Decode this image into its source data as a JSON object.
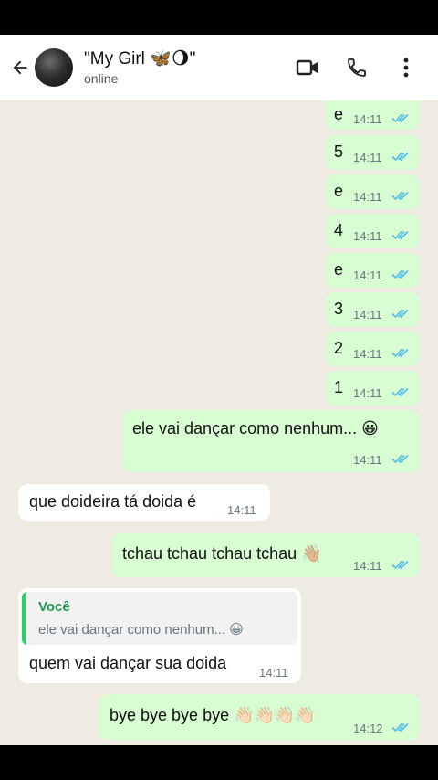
{
  "header": {
    "contact_name": "\"My Girl 🦋🌖\"",
    "status": "online"
  },
  "colors": {
    "outgoing_bubble": "#d9fdd3",
    "incoming_bubble": "#ffffff",
    "chat_background": "#efeae2",
    "read_ticks": "#53bdeb",
    "quote_accent": "#25d366"
  },
  "icons": {
    "back": "arrow-left-icon",
    "video": "video-camera-icon",
    "call": "phone-icon",
    "menu": "more-vertical-icon",
    "read_receipt": "double-check-icon"
  },
  "messages": [
    {
      "direction": "out",
      "text": "e",
      "time": "14:11"
    },
    {
      "direction": "out",
      "text": "5",
      "time": "14:11"
    },
    {
      "direction": "out",
      "text": "e",
      "time": "14:11"
    },
    {
      "direction": "out",
      "text": "4",
      "time": "14:11"
    },
    {
      "direction": "out",
      "text": "e",
      "time": "14:11"
    },
    {
      "direction": "out",
      "text": "3",
      "time": "14:11"
    },
    {
      "direction": "out",
      "text": "2",
      "time": "14:11"
    },
    {
      "direction": "out",
      "text": "1",
      "time": "14:11"
    },
    {
      "direction": "out",
      "text": "ele vai dançar como nenhum... 😀",
      "time": "14:11"
    },
    {
      "direction": "in",
      "text": "que doideira tá doida é",
      "time": "14:11"
    },
    {
      "direction": "out",
      "text": "tchau tchau tchau tchau 👋🏼",
      "time": "14:11"
    },
    {
      "direction": "in",
      "quote_author": "Você",
      "quote_text": "ele vai dançar como nenhum... 😀",
      "text": "quem vai dançar sua doida",
      "time": "14:11"
    },
    {
      "direction": "out",
      "text": "bye bye bye bye 👋🏻👋🏻👋🏻👋🏻",
      "time": "14:12"
    }
  ]
}
